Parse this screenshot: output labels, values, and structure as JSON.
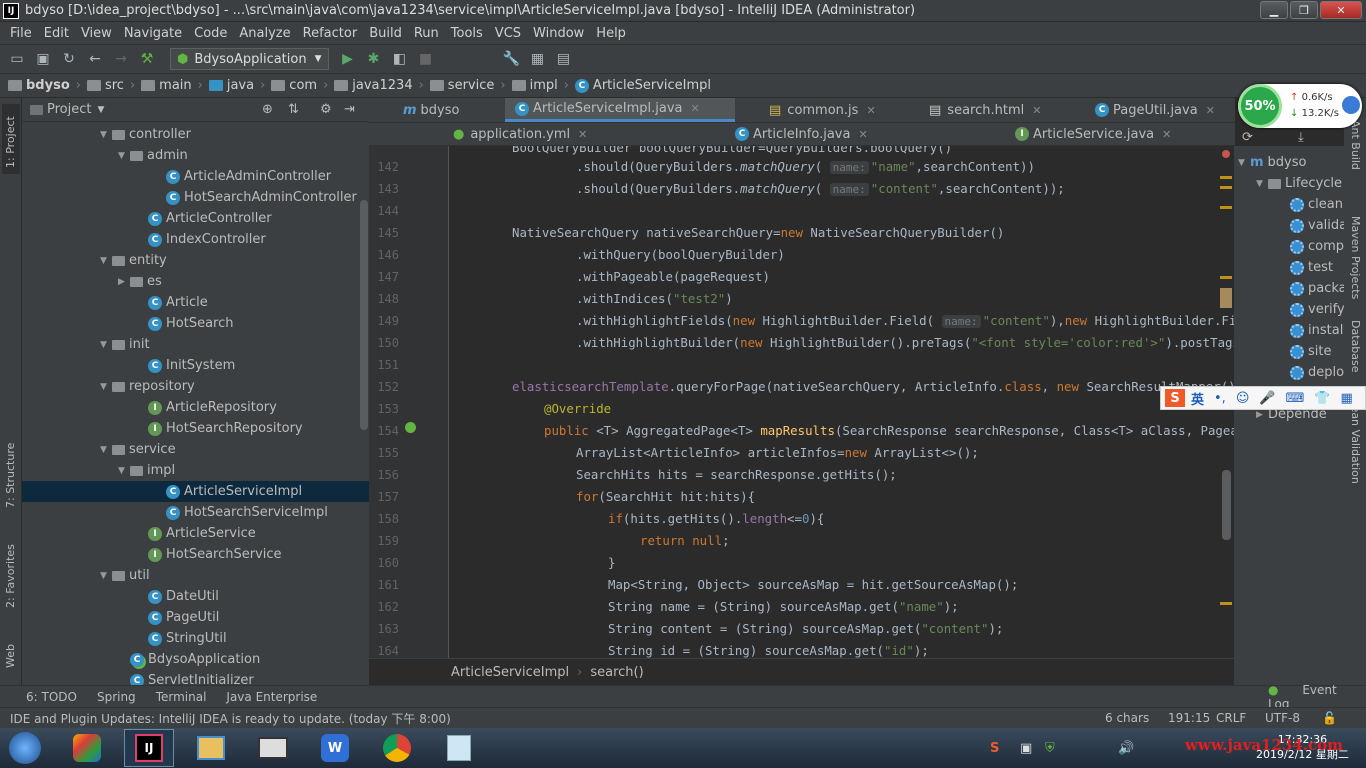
{
  "window": {
    "title": "bdyso [D:\\idea_project\\bdyso] - ...\\src\\main\\java\\com\\java1234\\service\\impl\\ArticleServiceImpl.java [bdyso] - IntelliJ IDEA (Administrator)",
    "app_icon": "IJ"
  },
  "menu": [
    "File",
    "Edit",
    "View",
    "Navigate",
    "Code",
    "Analyze",
    "Refactor",
    "Build",
    "Run",
    "Tools",
    "VCS",
    "Window",
    "Help"
  ],
  "toolbar": {
    "run_config": "BdysoApplication"
  },
  "breadcrumbs": [
    "bdyso",
    "src",
    "main",
    "java",
    "com",
    "java1234",
    "service",
    "impl",
    "ArticleServiceImpl"
  ],
  "project": {
    "header": "Project",
    "tree": [
      {
        "label": "controller",
        "type": "folder",
        "depth": 0,
        "open": true
      },
      {
        "label": "admin",
        "type": "folder",
        "depth": 1,
        "open": true
      },
      {
        "label": "ArticleAdminController",
        "type": "class",
        "depth": 2
      },
      {
        "label": "HotSearchAdminController",
        "type": "class",
        "depth": 2
      },
      {
        "label": "ArticleController",
        "type": "class",
        "depth": 1
      },
      {
        "label": "IndexController",
        "type": "class",
        "depth": 1
      },
      {
        "label": "entity",
        "type": "folder",
        "depth": 0,
        "open": true
      },
      {
        "label": "es",
        "type": "folder",
        "depth": 1,
        "open": false
      },
      {
        "label": "Article",
        "type": "class",
        "depth": 1
      },
      {
        "label": "HotSearch",
        "type": "class",
        "depth": 1
      },
      {
        "label": "init",
        "type": "folder",
        "depth": 0,
        "open": true
      },
      {
        "label": "InitSystem",
        "type": "class",
        "depth": 1
      },
      {
        "label": "repository",
        "type": "folder",
        "depth": 0,
        "open": true
      },
      {
        "label": "ArticleRepository",
        "type": "interface",
        "depth": 1
      },
      {
        "label": "HotSearchRepository",
        "type": "interface",
        "depth": 1
      },
      {
        "label": "service",
        "type": "folder",
        "depth": 0,
        "open": true
      },
      {
        "label": "impl",
        "type": "folder",
        "depth": 1,
        "open": true
      },
      {
        "label": "ArticleServiceImpl",
        "type": "class",
        "depth": 2,
        "selected": true
      },
      {
        "label": "HotSearchServiceImpl",
        "type": "class",
        "depth": 2
      },
      {
        "label": "ArticleService",
        "type": "interface",
        "depth": 1
      },
      {
        "label": "HotSearchService",
        "type": "interface",
        "depth": 1
      },
      {
        "label": "util",
        "type": "folder",
        "depth": 0,
        "open": true
      },
      {
        "label": "DateUtil",
        "type": "class",
        "depth": 1
      },
      {
        "label": "PageUtil",
        "type": "class",
        "depth": 1
      },
      {
        "label": "StringUtil",
        "type": "class",
        "depth": 1
      },
      {
        "label": "BdysoApplication",
        "type": "app",
        "depth": 0
      },
      {
        "label": "ServletInitializer",
        "type": "class",
        "depth": 0
      }
    ]
  },
  "tabs_row1": [
    {
      "label": "bdyso",
      "icon": "m"
    },
    {
      "label": "ArticleServiceImpl.java",
      "icon": "class",
      "active": true
    },
    {
      "label": "common.js",
      "icon": "js"
    },
    {
      "label": "search.html",
      "icon": "html"
    },
    {
      "label": "PageUtil.java",
      "icon": "class"
    }
  ],
  "tabs_row2": [
    {
      "label": "application.yml",
      "icon": "yml"
    },
    {
      "label": "ArticleInfo.java",
      "icon": "class"
    },
    {
      "label": "ArticleService.java",
      "icon": "interface"
    }
  ],
  "code": {
    "line_numbers": [
      "142",
      "143",
      "144",
      "145",
      "146",
      "147",
      "148",
      "149",
      "150",
      "151",
      "152",
      "153",
      "154",
      "155",
      "156",
      "157",
      "158",
      "159",
      "160",
      "161",
      "162",
      "163",
      "164"
    ],
    "hint_name": "name:",
    "strings": {
      "name": "\"name\"",
      "content": "\"content\"",
      "test2": "\"test2\"",
      "font": "\"<font style='color:red'>\"",
      "id": "\"id\""
    }
  },
  "editor_breadcrumb": [
    "ArticleServiceImpl",
    "search()"
  ],
  "maven": {
    "root": "bdyso",
    "lifecycle": "Lifecycle",
    "goals": [
      "clean",
      "valida",
      "compi",
      "test",
      "packa",
      "verify",
      "install",
      "site",
      "deplo"
    ],
    "deps": "Depende"
  },
  "stripes": {
    "left": [
      "1: Project",
      "7: Structure",
      "2: Favorites",
      "Web"
    ],
    "right": [
      "Ant Build",
      "Maven Projects",
      "Database",
      "Bean Validation"
    ]
  },
  "toolwindows": [
    "6: TODO",
    "Spring",
    "Terminal",
    "Java Enterprise"
  ],
  "event_log": "Event Log",
  "status": {
    "message": "IDE and Plugin Updates: IntelliJ IDEA is ready to update. (today 下午 8:00)",
    "chars": "6 chars",
    "position": "191:15",
    "line_sep": "CRLF",
    "encoding": "UTF-8"
  },
  "net_meter": {
    "percent": "50%",
    "up": "0.6K/s",
    "down": "13.2K/s"
  },
  "ime": {
    "lang": "英"
  },
  "clock": {
    "time": "17:32:36",
    "date": "2019/2/12 星期二"
  },
  "watermark": "www.java1234.com"
}
